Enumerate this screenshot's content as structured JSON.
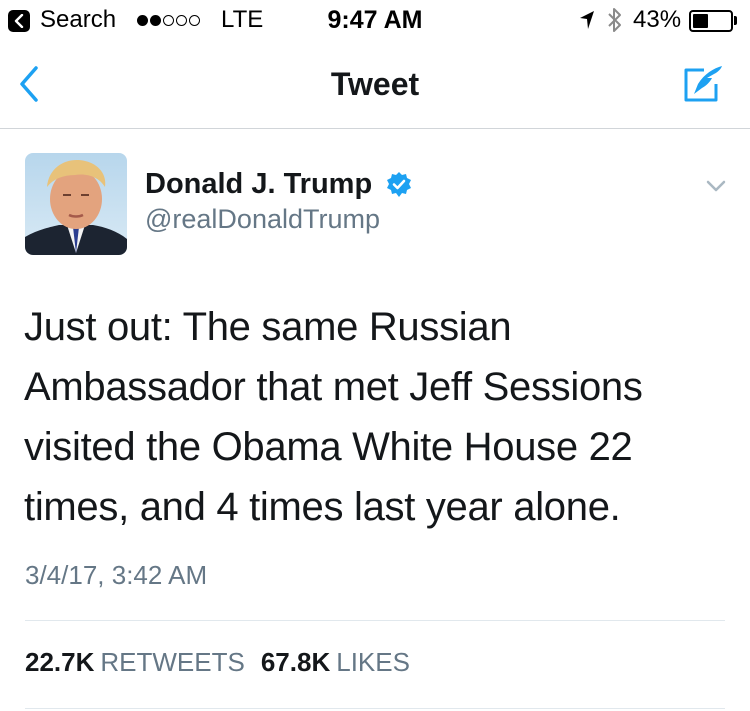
{
  "status_bar": {
    "back_app": "Search",
    "carrier": "LTE",
    "time": "9:47 AM",
    "battery_percent": "43%",
    "battery_level": 0.43,
    "signal_bars_filled": 2,
    "signal_bars_total": 5
  },
  "nav": {
    "title": "Tweet",
    "back_icon": "chevron-left-icon",
    "compose_icon": "compose-tweet-icon"
  },
  "tweet": {
    "author_name": "Donald J. Trump",
    "author_handle": "@realDonaldTrump",
    "verified": true,
    "text_lines": [
      "Just out: The same Russian",
      "Ambassador that met Jeff Sessions",
      "visited the Obama White House 22",
      "times, and 4 times last year alone."
    ],
    "timestamp": "3/4/17, 3:42 AM",
    "retweets_count": "22.7K",
    "retweets_label": "RETWEETS",
    "likes_count": "67.8K",
    "likes_label": "LIKES"
  },
  "colors": {
    "accent": "#1da1f2",
    "text_primary": "#14171a",
    "text_secondary": "#657786",
    "divider": "#e1e8ed"
  }
}
